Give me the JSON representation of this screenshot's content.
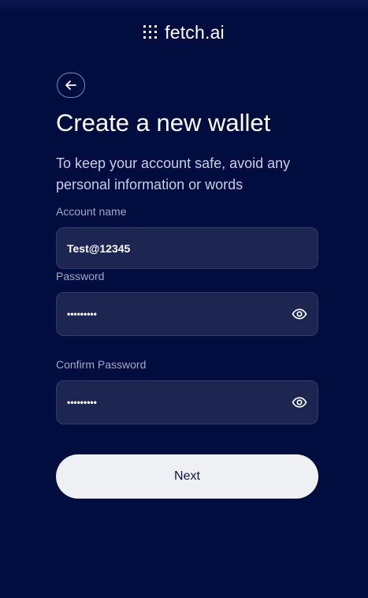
{
  "brand": {
    "name": "fetch.ai",
    "logo_icon": "dot-grid-icon"
  },
  "header": {
    "back_icon": "arrow-left-icon",
    "title": "Create a new wallet",
    "subtitle": "To keep your account safe, avoid any personal information or words"
  },
  "form": {
    "account_name": {
      "label": "Account name",
      "value": "Test@12345"
    },
    "password": {
      "label": "Password",
      "value": "Test@1234",
      "toggle_icon": "eye-icon"
    },
    "confirm_password": {
      "label": "Confirm Password",
      "value": "Test@1234",
      "toggle_icon": "eye-icon"
    }
  },
  "actions": {
    "next_label": "Next"
  },
  "colors": {
    "background": "#020d3f",
    "field_bg": "#1c2650",
    "button_bg": "#eff0f4",
    "button_text": "#0d1440"
  }
}
